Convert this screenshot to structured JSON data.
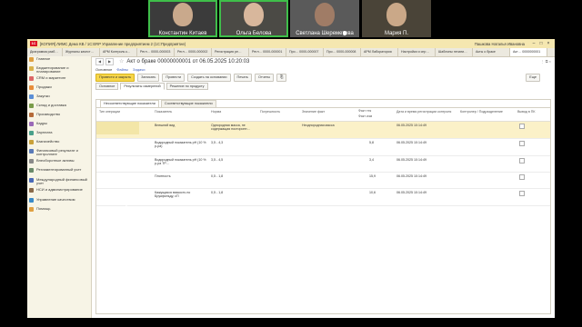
{
  "participants": [
    {
      "name": "Константин Китаев",
      "active": true,
      "bg": "#3b3b3b",
      "face": "#c9a98c"
    },
    {
      "name": "Ольга Белова",
      "active": true,
      "bg": "#4b4a45",
      "face": "#d8b79c"
    },
    {
      "name": "Светлана Шереметова",
      "active": false,
      "bg": "#5a5a5a",
      "face": "#a07c66"
    },
    {
      "name": "Мария П.",
      "active": false,
      "bg": "#4a4438",
      "face": "#caa888"
    }
  ],
  "app": {
    "window_title": "[КОПИЯ] ЛИМС Демо КВ / 1С:ERP Управление предприятием 2 (1С:Предприятие)",
    "user": "Пашкова Наталья Ивановна",
    "tabs": [
      "Диаграмма разб…",
      "Журналы качест…",
      "АРМ Контроль к…",
      "Регл… 0000-000003",
      "Регл… 0000-000002",
      "Регистрация ре…",
      "Регл… 0000-000001",
      "Про… 0000-000007",
      "Про… 0000-000008",
      "АРМ Лаборатория",
      "Настройки и спр…",
      "Шаблоны печати…",
      "Акты о браке",
      "Акт… 0000000001"
    ],
    "sidebar": [
      {
        "label": "Главное",
        "color": "#e0a040"
      },
      {
        "label": "Бюджетирование и планирование",
        "color": "#d9b24a"
      },
      {
        "label": "CRM и маркетинг",
        "color": "#d66"
      },
      {
        "label": "Продажи",
        "color": "#e88d3a"
      },
      {
        "label": "Закупки",
        "color": "#5a8ed6"
      },
      {
        "label": "Склад и доставка",
        "color": "#7a9c4a"
      },
      {
        "label": "Производство",
        "color": "#b56a3a"
      },
      {
        "label": "Кадры",
        "color": "#9b6ab8"
      },
      {
        "label": "Зарплата",
        "color": "#4aa08a"
      },
      {
        "label": "Казначейство",
        "color": "#c9a13a"
      },
      {
        "label": "Финансовый результат и контроллинг",
        "color": "#5a7ab8"
      },
      {
        "label": "Внеоборотные активы",
        "color": "#8a8a8a"
      },
      {
        "label": "Регламентированный учет",
        "color": "#6a8a6a"
      },
      {
        "label": "Международный финансовый учет",
        "color": "#4a6ab8"
      },
      {
        "label": "НСИ и администрирование",
        "color": "#8a6a4a"
      },
      {
        "label": "Управление качеством",
        "color": "#3a8ac8"
      },
      {
        "label": "Помощь",
        "color": "#e0a040"
      }
    ],
    "doc_title": "Акт о браке 00000000001 от 06.05.2025 10:20:03",
    "doc_links": [
      "Основное",
      "Файлы",
      "Задачи"
    ],
    "toolbar": {
      "post_close": "Провести и закрыть",
      "save": "Записать",
      "post": "Провести",
      "create_basis": "Создать на основании",
      "print": "Печать",
      "reports": "Отчеты",
      "more": "Еще"
    },
    "subtabs": [
      "Основное",
      "Результаты измерений",
      "Решение по продукту"
    ],
    "panel_tabs": [
      "Несоответствующие показатели",
      "Соответствующие показатели"
    ],
    "columns": [
      "Тип операции",
      "Показатель",
      "Норма",
      "Погрешность",
      "Значение факт",
      "Факт тек",
      "Дата и время регистрации контроля",
      "Контролер / Подразделение",
      "Вывод в ПК"
    ],
    "subcolumns": {
      "fact_meas": "Факт изм"
    },
    "rows": [
      {
        "type": "",
        "indicator": "Внешний вид",
        "norm": "Однородная масса, не содержащая посторонн…",
        "error": "",
        "value": "Неоднородная масса",
        "fact": "",
        "date": "06.05.2025 10:14:49",
        "controller": "",
        "selected": true
      },
      {
        "type": "",
        "indicator": "Водородный показатель рН (10 % р-ра)",
        "norm": "3,5 - 4,3",
        "error": "",
        "value": "",
        "fact": "5,8",
        "date": "06.05.2025 10:14:49",
        "controller": "",
        "selected": false
      },
      {
        "type": "",
        "indicator": "Водородный показатель рН (10 % р-ра ТР…",
        "norm": "3,5 - 4,5",
        "error": "",
        "value": "",
        "fact": "3,4",
        "date": "06.05.2025 10:14:49",
        "controller": "",
        "selected": false
      },
      {
        "type": "",
        "indicator": "Плотность",
        "norm": "0,5 - 1,8",
        "error": "",
        "value": "",
        "fact": "15,9",
        "date": "06.05.2025 10:14:49",
        "controller": "",
        "selected": false
      },
      {
        "type": "",
        "indicator": "Кажущаяся вязкость по Брукфильду, сП",
        "norm": "0,5 - 1,8",
        "error": "",
        "value": "",
        "fact": "10,6",
        "date": "06.05.2025 10:14:49",
        "controller": "",
        "selected": false
      }
    ]
  }
}
